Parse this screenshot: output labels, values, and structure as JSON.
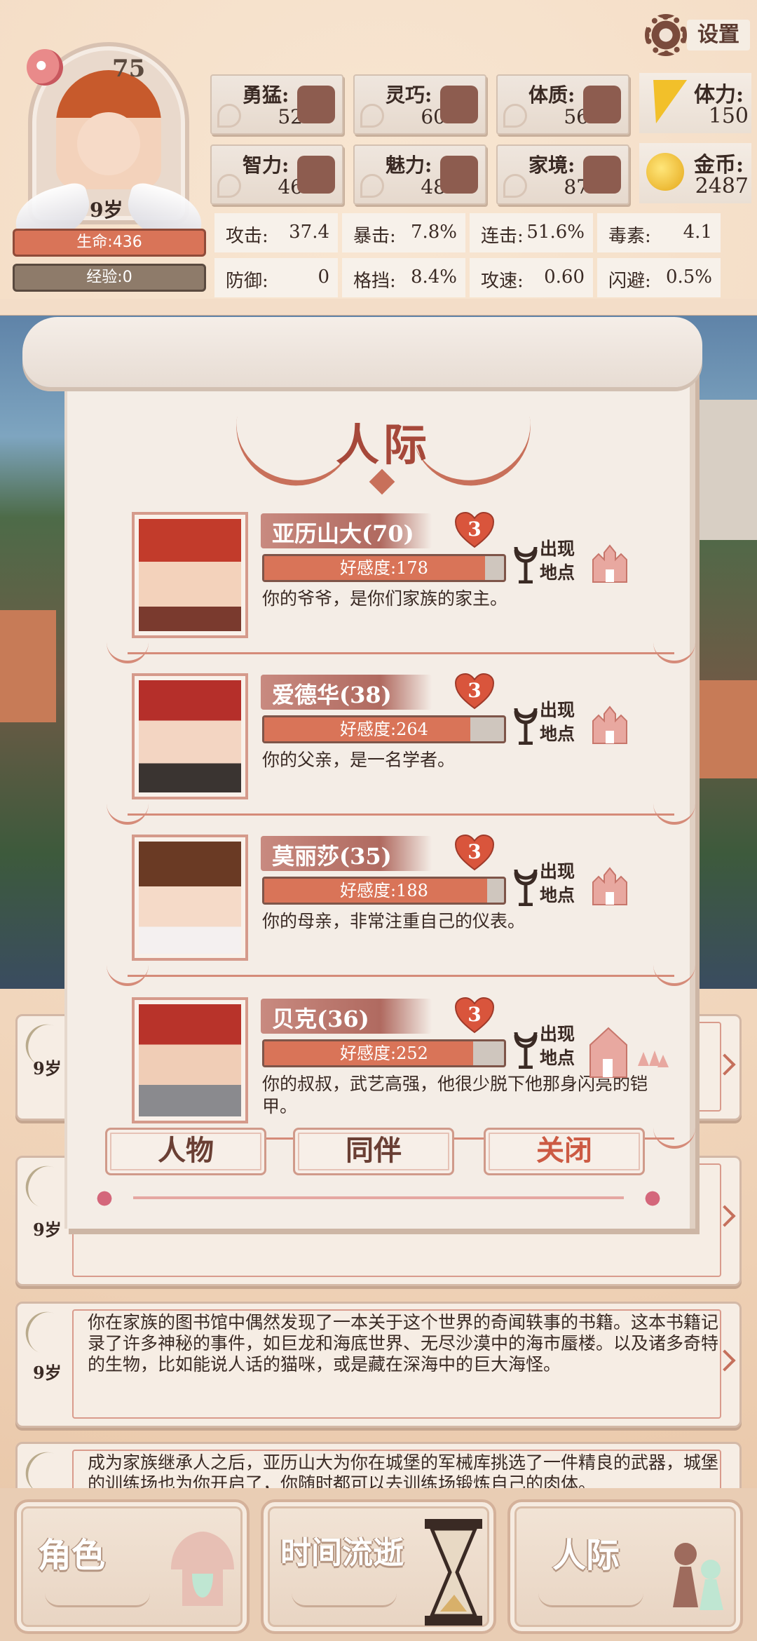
{
  "player": {
    "level": "75",
    "age": "9岁",
    "hp_label": "生命:436",
    "exp_label": "经验:0"
  },
  "settings_label": "设置",
  "stats": [
    {
      "name": "勇猛:",
      "value": "52",
      "icon": "fist-icon"
    },
    {
      "name": "灵巧:",
      "value": "60",
      "icon": "cloak-icon"
    },
    {
      "name": "体质:",
      "value": "56",
      "icon": "muscle-icon"
    },
    {
      "name": "智力:",
      "value": "46",
      "icon": "brain-icon"
    },
    {
      "name": "魅力:",
      "value": "48",
      "icon": "tulip-icon"
    },
    {
      "name": "家境:",
      "value": "87",
      "icon": "money-pouch-icon"
    }
  ],
  "resources": [
    {
      "name": "体力:",
      "value": "150",
      "icon": "lightning-icon"
    },
    {
      "name": "金币:",
      "value": "2487",
      "icon": "coin-icon"
    }
  ],
  "combat": [
    {
      "name": "攻击:",
      "value": "37.4"
    },
    {
      "name": "暴击:",
      "value": "7.8%"
    },
    {
      "name": "连击:",
      "value": "51.6%"
    },
    {
      "name": "毒素:",
      "value": "4.1"
    },
    {
      "name": "防御:",
      "value": "0"
    },
    {
      "name": "格挡:",
      "value": "8.4%"
    },
    {
      "name": "攻速:",
      "value": "0.60"
    },
    {
      "name": "闪避:",
      "value": "0.5%"
    }
  ],
  "dialog": {
    "title": "人际",
    "location_label_1": "出现",
    "location_label_2": "地点",
    "people": [
      {
        "name": "亚历山大(70)",
        "hearts": "3",
        "favor": "好感度:178",
        "favor_fraction": 0.92,
        "desc": "你的爷爷，是你们家族的家主。",
        "location": "castle-icon"
      },
      {
        "name": "爱德华(38)",
        "hearts": "3",
        "favor": "好感度:264",
        "favor_fraction": 0.86,
        "desc": "你的父亲，是一名学者。",
        "location": "castle-icon"
      },
      {
        "name": "莫丽莎(35)",
        "hearts": "3",
        "favor": "好感度:188",
        "favor_fraction": 0.93,
        "desc": "你的母亲，非常注重自己的仪表。",
        "location": "castle-icon"
      },
      {
        "name": "贝克(36)",
        "hearts": "3",
        "favor": "好感度:252",
        "favor_fraction": 0.87,
        "desc": "你的叔叔，武艺高强，他很少脱下他那身闪亮的铠甲。",
        "location": "house-forest-icon"
      }
    ],
    "buttons": {
      "character": "人物",
      "companion": "同伴",
      "close": "关闭"
    }
  },
  "log": [
    {
      "age": "9岁",
      "text": ""
    },
    {
      "age": "9岁",
      "text": ""
    },
    {
      "age": "9岁",
      "text": "你在家族的图书馆中偶然发现了一本关于这个世界的奇闻轶事的书籍。这本书籍记录了许多神秘的事件，如巨龙和海底世界、无尽沙漠中的海市蜃楼。以及诸多奇特的生物，比如能说人话的猫咪，或是藏在深海中的巨大海怪。"
    },
    {
      "age": "9岁",
      "text": "成为家族继承人之后，亚历山大为你在城堡的军械库挑选了一件精良的武器，城堡的训练场也为你开启了，你随时都可以去训练场锻炼自己的肉体。"
    }
  ],
  "nav": [
    {
      "label": "角色",
      "icon": "character-bust-icon"
    },
    {
      "label": "时间流逝",
      "icon": "hourglass-icon"
    },
    {
      "label": "人际",
      "icon": "chess-pawns-icon"
    }
  ],
  "colors": {
    "accent": "#d97458",
    "title": "#a6483a",
    "paper": "#f4ede6"
  }
}
